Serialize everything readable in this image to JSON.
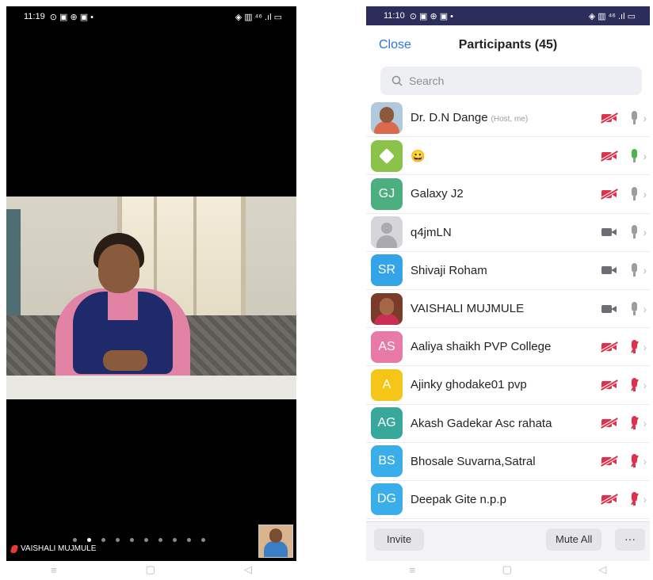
{
  "left_phone": {
    "status_time": "11:19",
    "status_icons_left": "⊙ ▣ ⊕ ▣ •",
    "status_icons_right": "◈ ▥ ⁴⁶ .ıl ▭",
    "active_speaker_name": "VAISHALI MUJMULE",
    "page_dots_count": 10,
    "active_dot_index": 1
  },
  "right_phone": {
    "status_time": "11:10",
    "status_icons_left": "⊙ ▣ ⊕ ▣ •",
    "status_icons_right": "◈ ▥ ⁴⁶ .ıl ▭",
    "close_label": "Close",
    "title": "Participants (45)",
    "search_placeholder": "Search",
    "participants": [
      {
        "name": "Dr. D.N Dange",
        "role": "(Host, me)",
        "avatar": "photo",
        "video": "off",
        "mic": "gray"
      },
      {
        "name": "😀",
        "role": "",
        "avatar": "icon",
        "avatar_color": "#8bc34a",
        "video": "off",
        "mic": "green"
      },
      {
        "name": "Galaxy J2",
        "role": "",
        "avatar": "GJ",
        "avatar_color": "#4caf7f",
        "video": "off",
        "mic": "gray"
      },
      {
        "name": "q4jmLN",
        "role": "",
        "avatar": "default",
        "video": "on",
        "mic": "gray"
      },
      {
        "name": "Shivaji Roham",
        "role": "",
        "avatar": "SR",
        "avatar_color": "#33a4e8",
        "video": "on",
        "mic": "gray"
      },
      {
        "name": "VAISHALI MUJMULE",
        "role": "",
        "avatar": "photo2",
        "video": "on",
        "mic": "gray"
      },
      {
        "name": "Aaliya shaikh PVP College",
        "role": "",
        "avatar": "AS",
        "avatar_color": "#e87aa8",
        "video": "off",
        "mic": "red"
      },
      {
        "name": "Ajinky  ghodake01 pvp",
        "role": "",
        "avatar": "A",
        "avatar_color": "#f5c518",
        "video": "off",
        "mic": "red"
      },
      {
        "name": "Akash Gadekar Asc rahata",
        "role": "",
        "avatar": "AG",
        "avatar_color": "#38a89d",
        "video": "off",
        "mic": "red"
      },
      {
        "name": "Bhosale Suvarna,Satral",
        "role": "",
        "avatar": "BS",
        "avatar_color": "#39aee8",
        "video": "off",
        "mic": "red"
      },
      {
        "name": "Deepak Gite n.p.p",
        "role": "",
        "avatar": "DG",
        "avatar_color": "#39aee8",
        "video": "off",
        "mic": "red"
      }
    ],
    "invite_label": "Invite",
    "mute_all_label": "Mute All",
    "more_label": "···"
  },
  "nav_icons": [
    "≡",
    "▢",
    "◁"
  ]
}
